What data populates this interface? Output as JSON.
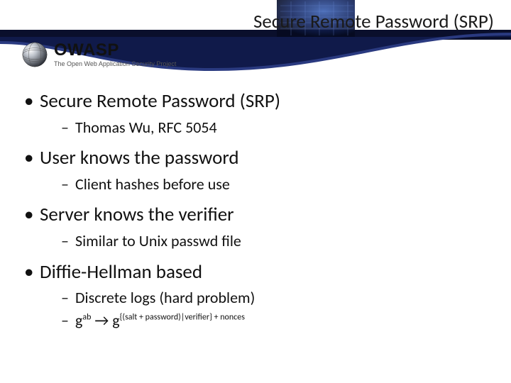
{
  "title": "Secure Remote Password (SRP)",
  "logo": {
    "name": "OWASP",
    "tagline": "The Open Web Application Security Project"
  },
  "bullets": {
    "b1": "Secure Remote Password (SRP)",
    "b1a": "Thomas Wu, RFC 5054",
    "b2": "User knows the password",
    "b2a": "Client hashes before use",
    "b3": "Server knows the verifier",
    "b3a": "Similar to Unix passwd file",
    "b4": "Diffie-Hellman based",
    "b4a": "Discrete logs (hard problem)",
    "b4b_base1": "g",
    "b4b_exp1": "ab",
    "b4b_arrow": " → ",
    "b4b_base2": "g",
    "b4b_exp2": "{(salt + password)|verifier} + nonces"
  }
}
